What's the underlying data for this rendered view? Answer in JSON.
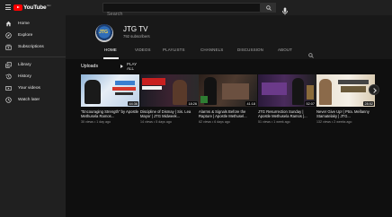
{
  "app": {
    "logo_text": "YouTube",
    "logo_region": "GH"
  },
  "search": {
    "placeholder": "Search"
  },
  "sidebar": {
    "items": [
      {
        "label": "Home",
        "icon": "home-icon"
      },
      {
        "label": "Explore",
        "icon": "compass-icon"
      },
      {
        "label": "Subscriptions",
        "icon": "subscriptions-icon"
      },
      {
        "label": "Library",
        "icon": "library-icon"
      },
      {
        "label": "History",
        "icon": "history-icon"
      },
      {
        "label": "Your videos",
        "icon": "your-videos-icon"
      },
      {
        "label": "Watch later",
        "icon": "clock-icon"
      }
    ]
  },
  "channel": {
    "avatar_text": "JTG",
    "name": "JTG TV",
    "subscribers": "792 subscribers",
    "tabs": [
      "HOME",
      "VIDEOS",
      "PLAYLISTS",
      "CHANNELS",
      "DISCUSSION",
      "ABOUT"
    ],
    "active_tab": "HOME"
  },
  "uploads": {
    "title": "Uploads",
    "play_all": "PLAY ALL",
    "videos": [
      {
        "title": "\"Encouraging Strength\" by Apostle Methusela Ramos...",
        "meta": "30 views • 1 day ago",
        "duration": "44:36"
      },
      {
        "title": "Discipline of Dismay | Sis. Lea Mayor | JTG Midweek...",
        "meta": "14 views • 5 days ago",
        "duration": "18:26"
      },
      {
        "title": "Alarms & Signals Before the Rapture | Apostle Methusel...",
        "meta": "62 views • 6 days ago",
        "duration": "41:18"
      },
      {
        "title": "JTG Resurrection Sunday | Apostle Methusela Ramos |...",
        "meta": "51 views • 1 week ago",
        "duration": "52:07"
      },
      {
        "title": "Never Give Up! | Ptra. Mellanny Stamatelaky | JTG...",
        "meta": "132 views • 2 weeks ago",
        "duration": "28:52"
      }
    ]
  },
  "colors": {
    "background": "#0f0f0f",
    "sidebar": "#202020",
    "brand_red": "#ff0000"
  }
}
